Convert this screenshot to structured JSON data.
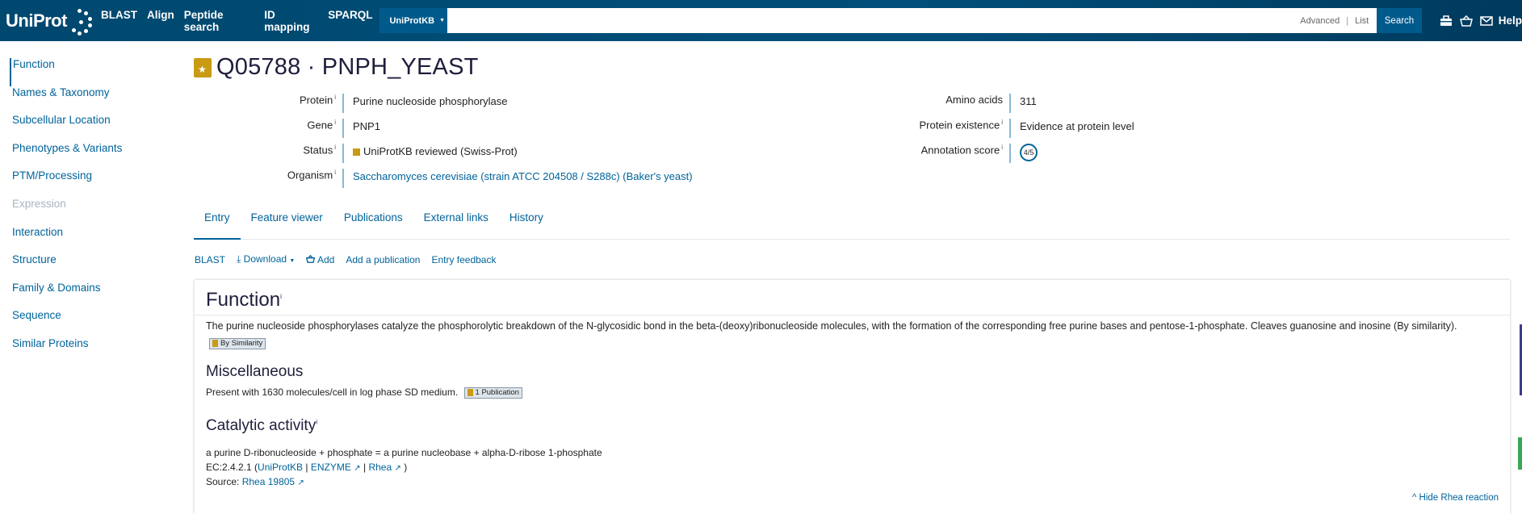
{
  "header": {
    "logo_text": "UniProt",
    "nav": [
      "BLAST",
      "Align",
      "Peptide search",
      "ID mapping",
      "SPARQL"
    ],
    "db_select": "UniProtKB",
    "search_placeholder": "",
    "advanced": "Advanced",
    "list": "List",
    "search_button": "Search",
    "help": "Help",
    "icons": [
      "toolbox-icon",
      "basket-icon",
      "mail-icon"
    ]
  },
  "sidebar": {
    "items": [
      {
        "label": "Function",
        "state": "active"
      },
      {
        "label": "Names & Taxonomy",
        "state": "normal"
      },
      {
        "label": "Subcellular Location",
        "state": "normal"
      },
      {
        "label": "Phenotypes & Variants",
        "state": "normal"
      },
      {
        "label": "PTM/Processing",
        "state": "normal"
      },
      {
        "label": "Expression",
        "state": "disabled"
      },
      {
        "label": "Interaction",
        "state": "normal"
      },
      {
        "label": "Structure",
        "state": "normal"
      },
      {
        "label": "Family & Domains",
        "state": "normal"
      },
      {
        "label": "Sequence",
        "state": "normal"
      },
      {
        "label": "Similar Proteins",
        "state": "normal"
      }
    ]
  },
  "entry": {
    "title": "Q05788 · PNPH_YEAST",
    "left": [
      {
        "label": "Protein",
        "value": "Purine nucleoside phosphorylase"
      },
      {
        "label": "Gene",
        "value": "PNP1"
      },
      {
        "label": "Status",
        "value": "UniProtKB reviewed (Swiss-Prot)"
      },
      {
        "label": "Organism",
        "value": "Saccharomyces cerevisiae (strain ATCC 204508 / S288c) (Baker's yeast)"
      }
    ],
    "right": [
      {
        "label": "Amino acids",
        "value": "311"
      },
      {
        "label": "Protein existence",
        "value": "Evidence at protein level"
      },
      {
        "label": "Annotation score",
        "value": "4/5"
      }
    ],
    "info_marker": "i"
  },
  "tabs": [
    "Entry",
    "Feature viewer",
    "Publications",
    "External links",
    "History"
  ],
  "actions": {
    "blast": "BLAST",
    "download": "Download",
    "add": "Add",
    "add_publication": "Add a publication",
    "entry_feedback": "Entry feedback"
  },
  "function_section": {
    "title": "Function",
    "text": "The purine nucleoside phosphorylases catalyze the phosphorolytic breakdown of the N-glycosidic bond in the beta-(deoxy)ribonucleoside molecules, with the formation of the corresponding free purine bases and pentose-1-phosphate. Cleaves guanosine and inosine (By similarity).",
    "tag": "By Similarity",
    "misc_title": "Miscellaneous",
    "misc_text": "Present with 1630 molecules/cell in log phase SD medium.",
    "misc_tag": "1 Publication",
    "catalytic_title": "Catalytic activity",
    "reaction": "a purine D-ribonucleoside + phosphate = a purine nucleobase + alpha-D-ribose 1-phosphate",
    "ec_prefix": "EC:2.4.2.1 (",
    "ec_links": [
      "UniProtKB",
      "ENZYME",
      "Rhea"
    ],
    "ec_suffix": ")",
    "source_label": "Source:",
    "source_link": "Rhea 19805",
    "hide_rhea": "Hide Rhea reaction"
  }
}
